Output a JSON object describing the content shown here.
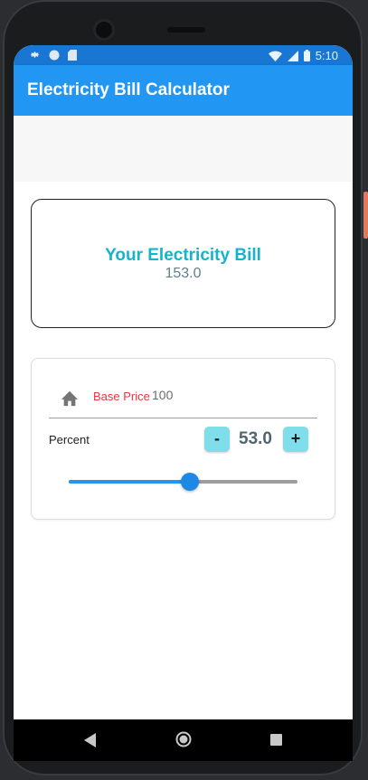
{
  "status_bar": {
    "time": "5:10",
    "left_icons": [
      "settings-icon",
      "circle-icon",
      "sd-card-icon"
    ],
    "right_icons": [
      "wifi-icon",
      "signal-icon",
      "battery-icon"
    ]
  },
  "app_bar": {
    "title": "Electricity Bill Calculator"
  },
  "bill_card": {
    "title": "Your Electricity Bill",
    "value": "153.0"
  },
  "calculator": {
    "base_price": {
      "icon": "home-icon",
      "label": "Base Price",
      "value": "100"
    },
    "percent": {
      "label": "Percent",
      "minus_label": "-",
      "plus_label": "+",
      "value": "53.0",
      "slider_fraction": 0.53
    }
  },
  "colors": {
    "app_bar": "#2196f3",
    "status_bar": "#1976d2",
    "bill_title": "#16b3cc",
    "base_label": "#e53935",
    "button": "#80deea",
    "slider_active": "#2196f3"
  },
  "nav_bar": {
    "icons": [
      "back-icon",
      "home-circle-icon",
      "recents-icon"
    ]
  }
}
